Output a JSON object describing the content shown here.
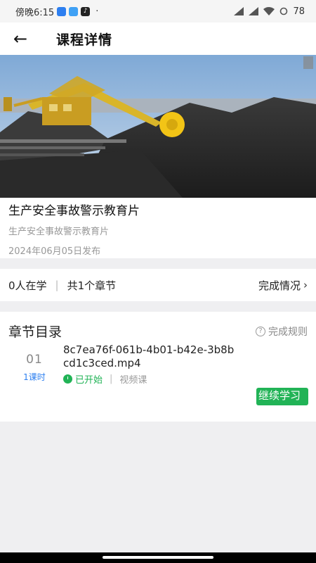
{
  "status_bar": {
    "time": "傍晚6:15",
    "tiktok_glyph": "♪",
    "dot": "·",
    "battery": "78"
  },
  "nav": {
    "back_arrow": "←",
    "title": "课程详情"
  },
  "course": {
    "title": "生产安全事故警示教育片",
    "subtitle": "生产安全事故警示教育片",
    "published": "2024年06月05日发布"
  },
  "stats": {
    "learners": "0人在学",
    "separator": "|",
    "chapters": "共1个章节",
    "completion_link": "完成情况",
    "chevron": "›"
  },
  "chapter_list": {
    "heading": "章节目录",
    "rules_link": "完成规则",
    "rules_icon_glyph": "?",
    "lessons": [
      {
        "index": "01",
        "hours": "1课时",
        "name": "8c7ea76f-061b-4b01-b42e-3b8bcd1c3ced.mp4",
        "status": "已开始",
        "separator": "|",
        "type": "视频课",
        "action": "继续学习"
      }
    ]
  },
  "colors": {
    "accent_green": "#21b356",
    "accent_blue": "#2d7ff0"
  },
  "icons": [
    "back-arrow-icon",
    "question-circle-icon",
    "clock-icon",
    "chevron-right-icon",
    "wifi-icon",
    "signal-icon",
    "battery-icon"
  ]
}
